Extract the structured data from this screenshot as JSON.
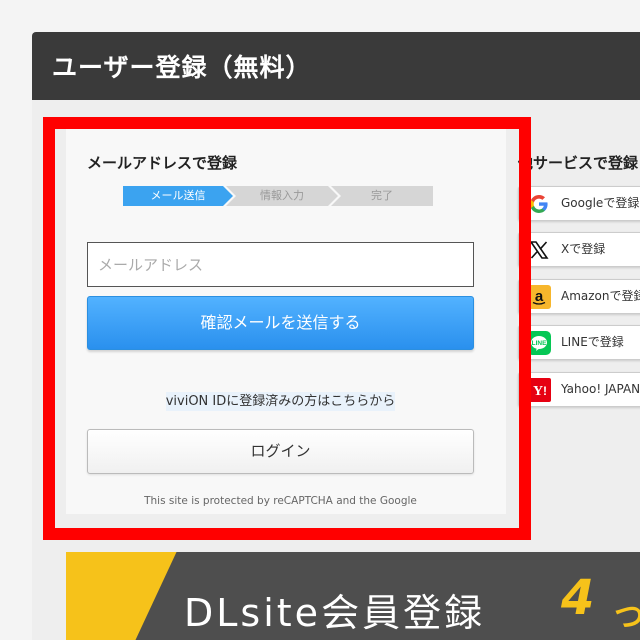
{
  "header": {
    "title": "ユーザー登録（無料）"
  },
  "email_section": {
    "title": "メールアドレスで登録",
    "steps": [
      "メール送信",
      "情報入力",
      "完了"
    ],
    "email_placeholder": "メールアドレス",
    "send_button": "確認メールを送信する",
    "login_note": "viviON IDに登録済みの方はこちらから",
    "login_button": "ログイン",
    "recaptcha_note": "This site is protected by reCAPTCHA and the Google"
  },
  "other_services": {
    "title": "他サービスで登録",
    "items": [
      {
        "label": "Googleで登録",
        "icon": "google-icon"
      },
      {
        "label": "Xで登録",
        "icon": "x-icon"
      },
      {
        "label": "Amazonで登録",
        "icon": "amazon-icon"
      },
      {
        "label": "LINEで登録",
        "icon": "line-icon"
      },
      {
        "label": "Yahoo! JAPAN",
        "icon": "yahoo-icon"
      }
    ]
  },
  "banner": {
    "text": "DLsite会員登録",
    "number": "4",
    "suffix": "つ"
  },
  "colors": {
    "primary": "#3ba3f0",
    "highlight": "#ff0000",
    "banner_accent": "#f6c21a"
  }
}
